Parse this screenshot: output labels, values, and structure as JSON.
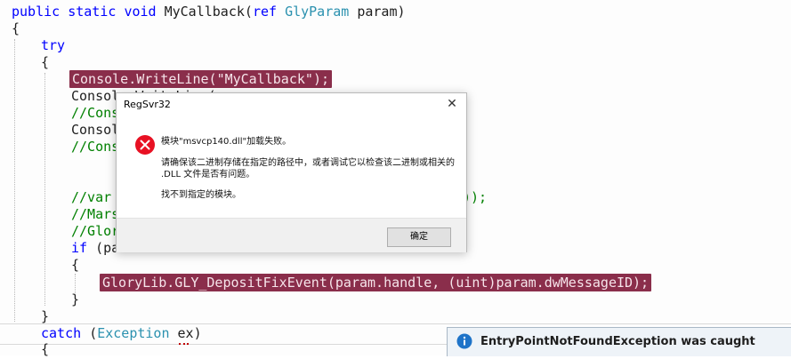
{
  "code": {
    "l1": {
      "kw1": "public",
      "kw2": "static",
      "kw3": "void",
      "name": "MyCallback(",
      "kw4": "ref",
      "type": "GlyParam",
      "rest": "param)"
    },
    "l2": "{",
    "l3": "try",
    "l4": "{",
    "l5": {
      "pre": "Console.WriteLine(",
      "str": "\"MyCallback\"",
      "post": ");"
    },
    "l6": "Console.WriteLine(",
    "l7": "//Conso",
    "l8": "Console",
    "l9": "//Conso",
    "l10": {
      "start": "//var",
      "end": "));"
    },
    "l11": "//Marsh",
    "l12": "//Glor",
    "l13": {
      "kw": "if",
      "rest": "(pa"
    },
    "l14": "{",
    "l15": "GloryLib.GLY_DepositFixEvent(param.handle, (uint)param.dwMessageID);",
    "l16": "}",
    "l17": "}",
    "l18": {
      "kw": "catch",
      "open": "(",
      "type": "Exception",
      "rest": "ex)"
    },
    "l19": "{"
  },
  "dialog": {
    "title": "RegSvr32",
    "close_glyph": "✕",
    "line1": "模块\"msvcp140.dll\"加载失败。",
    "line2": "请确保该二进制存储在指定的路径中，或者调试它以检查该二进制或相关的",
    "line3": ".DLL 文件是否有问题。",
    "line4": "找不到指定的模块。",
    "ok_label": "确定"
  },
  "exception": {
    "text": "EntryPointNotFoundException was caught"
  },
  "colors": {
    "highlight": "#8a2e4b",
    "keyword": "#0000ff",
    "type": "#2b91af",
    "string": "#a31515"
  }
}
